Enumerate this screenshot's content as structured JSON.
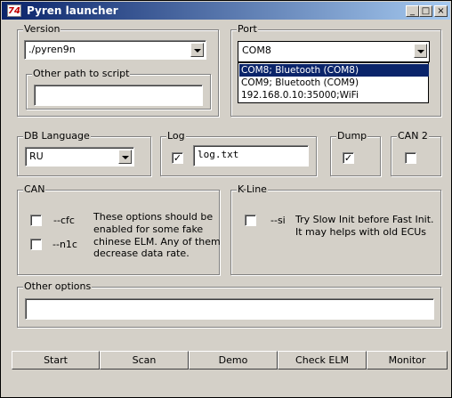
{
  "window": {
    "title": "Pyren launcher",
    "icon_text": "74"
  },
  "controls": {
    "minimize": "_",
    "maximize": "□",
    "close": "×"
  },
  "version": {
    "label": "Version",
    "selected": "./pyren9n",
    "other_path_label": "Other path to script",
    "other_path_value": ""
  },
  "port": {
    "label": "Port",
    "selected": "COM8",
    "options": [
      "COM8;    Bluetooth (COM8)",
      "COM9;    Bluetooth (COM9)",
      "192.168.0.10:35000;WiFi"
    ]
  },
  "db_language": {
    "label": "DB Language",
    "selected": "RU"
  },
  "log": {
    "label": "Log",
    "checked": true,
    "check_mark": "✓",
    "value": "log.txt"
  },
  "dump": {
    "label": "Dump",
    "checked": true,
    "check_mark": "✓"
  },
  "can2": {
    "label": "CAN 2",
    "checked": false
  },
  "can": {
    "label": "CAN",
    "cfc_label": "--cfc",
    "n1c_label": "--n1c",
    "desc_line1": "These options should be",
    "desc_line2": "enabled for some fake",
    "desc_line3": "chinese ELM. Any of them",
    "desc_line4": "decrease data rate."
  },
  "kline": {
    "label": "K-Line",
    "si_label": "--si",
    "desc_line1": "Try Slow Init before Fast Init.",
    "desc_line2": "It may helps with old ECUs"
  },
  "other_options": {
    "label": "Other options",
    "value": ""
  },
  "buttons": {
    "start": "Start",
    "scan": "Scan",
    "demo": "Demo",
    "check_elm": "Check ELM",
    "monitor": "Monitor"
  }
}
